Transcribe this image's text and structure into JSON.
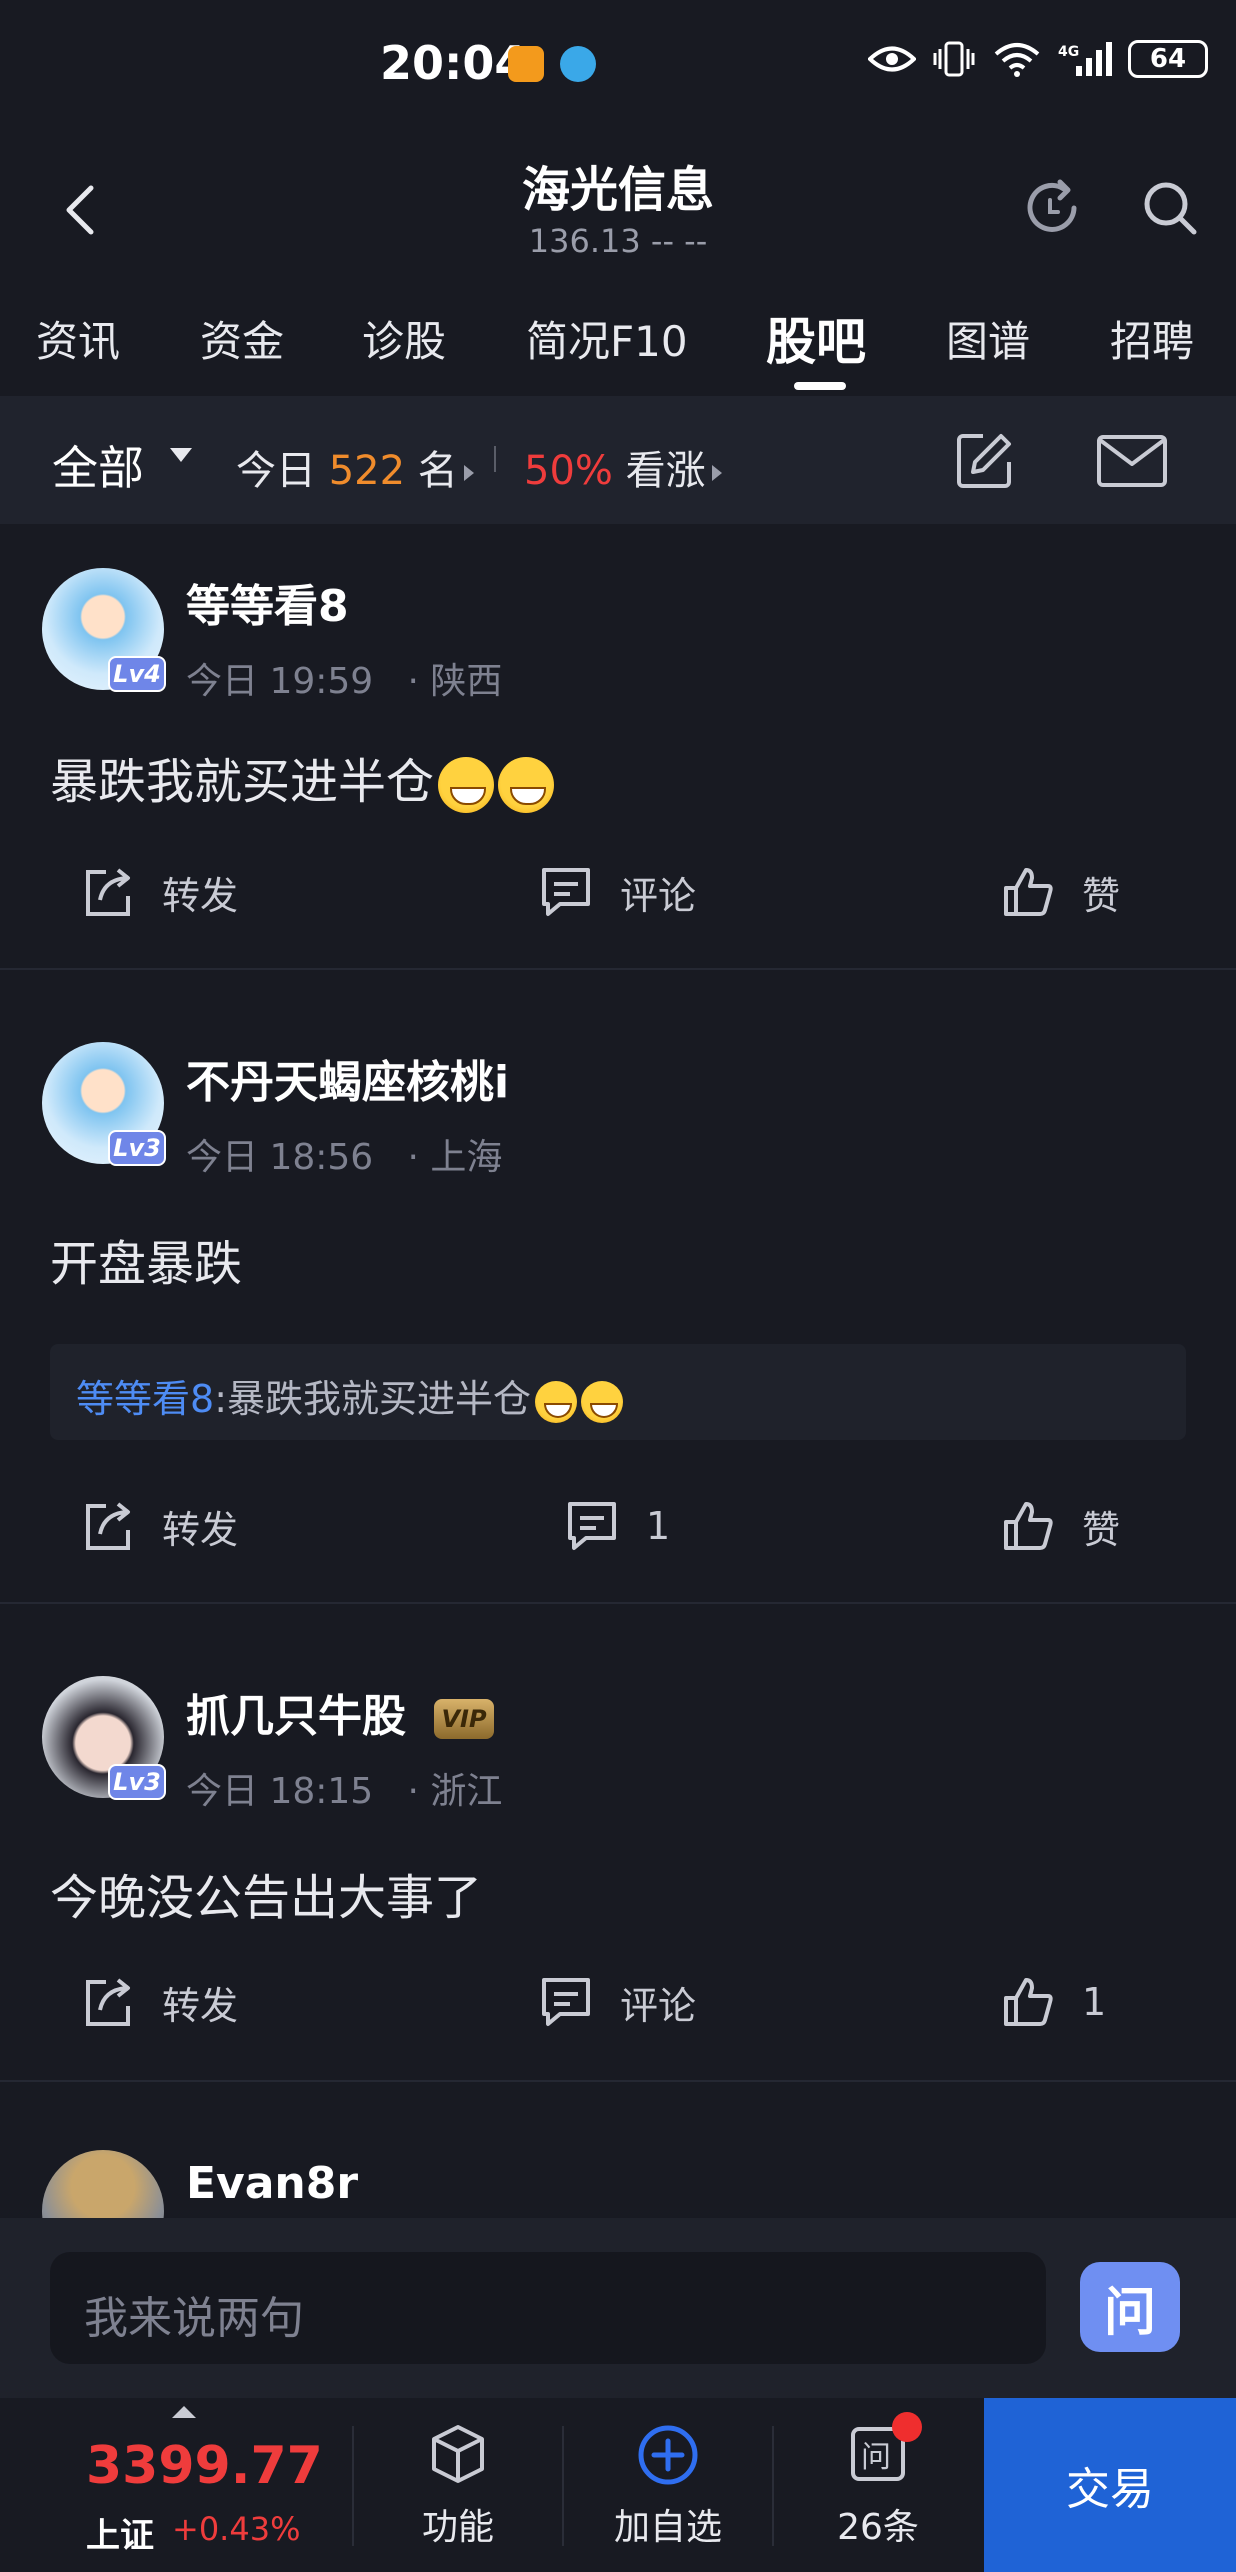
{
  "status_bar": {
    "time": "20:04",
    "battery": "64"
  },
  "header": {
    "title": "海光信息",
    "subtitle": "136.13  --  --"
  },
  "tabs": [
    {
      "label": "资讯"
    },
    {
      "label": "资金"
    },
    {
      "label": "诊股"
    },
    {
      "label": "简况F10"
    },
    {
      "label": "股吧",
      "active": true
    },
    {
      "label": "图谱"
    },
    {
      "label": "招聘"
    }
  ],
  "filter": {
    "all_label": "全部",
    "today_prefix": "今日",
    "today_count": "522",
    "today_suffix": "名",
    "bull_pct": "50%",
    "bull_label": "看涨"
  },
  "posts": [
    {
      "username": "等等看8",
      "level": "Lv4",
      "time": "今日 19:59",
      "location": "· 陕西",
      "content": "暴跌我就买进半仓",
      "actions": {
        "share": "转发",
        "comment": "评论",
        "like": "赞"
      }
    },
    {
      "username": "不丹天蝎座核桃i",
      "level": "Lv3",
      "time": "今日 18:56",
      "location": "· 上海",
      "content": "开盘暴跌",
      "quote": {
        "name": "等等看8",
        "text": ":暴跌我就买进半仓"
      },
      "actions": {
        "share": "转发",
        "comment": "1",
        "like": "赞"
      }
    },
    {
      "username": "抓几只牛股",
      "level": "Lv3",
      "vip": "VIP",
      "time": "今日 18:15",
      "location": "· 浙江",
      "content": "今晚没公告出大事了",
      "actions": {
        "share": "转发",
        "comment": "评论",
        "like": "1"
      }
    },
    {
      "username": "Evan8r"
    }
  ],
  "input_bar": {
    "placeholder": "我来说两句",
    "ask_label": "问"
  },
  "bottom_bar": {
    "index_value": "3399.77",
    "index_name": "上证",
    "index_change": "+0.43%",
    "function_label": "功能",
    "add_watch_label": "加自选",
    "count_label": "26条",
    "trade_label": "交易"
  },
  "colors": {
    "accent_red": "#ef3c3c",
    "accent_orange": "#f08c2c",
    "link_blue": "#4e8cf4",
    "trade_blue": "#1f63d6"
  }
}
